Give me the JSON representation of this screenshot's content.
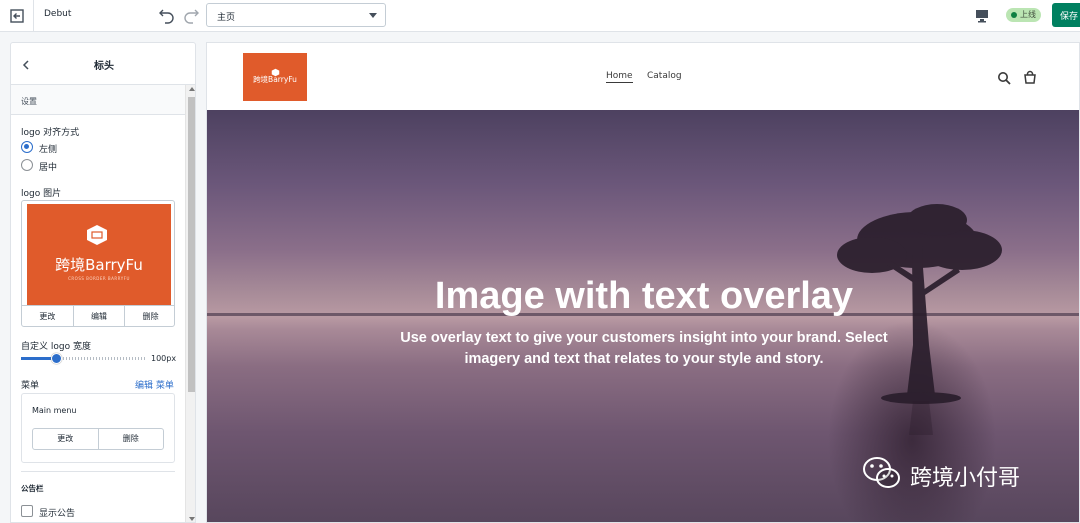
{
  "topbar": {
    "theme_name": "Debut",
    "page_select": "主页",
    "status": "上线",
    "save_label": "保存"
  },
  "sidebar": {
    "title": "标头",
    "section_label": "设置",
    "logo_align_label": "logo 对齐方式",
    "align_options": [
      {
        "label": "左侧",
        "checked": true
      },
      {
        "label": "居中",
        "checked": false
      }
    ],
    "logo_image_label": "logo 图片",
    "logo_brand": "跨境BarryFu",
    "logo_sub": "CROSS BORDER BARRYFU",
    "logo_buttons": [
      "更改",
      "编辑",
      "删除"
    ],
    "custom_width_label": "自定义 logo 宽度",
    "width_value": "100px",
    "width_fraction": 0.28,
    "menu_label": "菜单",
    "edit_menu_link": "编辑 菜单",
    "menu_name": "Main menu",
    "menu_buttons": [
      "更改",
      "删除"
    ],
    "announcement_title": "公告栏",
    "show_announcement_label": "显示公告",
    "show_announcement_checked": false
  },
  "preview": {
    "store_logo_text": "跨境BarryFu",
    "nav": [
      "Home",
      "Catalog"
    ],
    "hero_title": "Image with text overlay",
    "hero_text": "Use overlay text to give your customers insight into your brand. Select imagery and text that relates to your style and story."
  },
  "watermark": {
    "text": "跨境小付哥"
  },
  "colors": {
    "accent": "#2c6ecb",
    "save_green": "#008060",
    "logo_orange": "#e05b2b",
    "status_badge": "#bbe5b3"
  }
}
